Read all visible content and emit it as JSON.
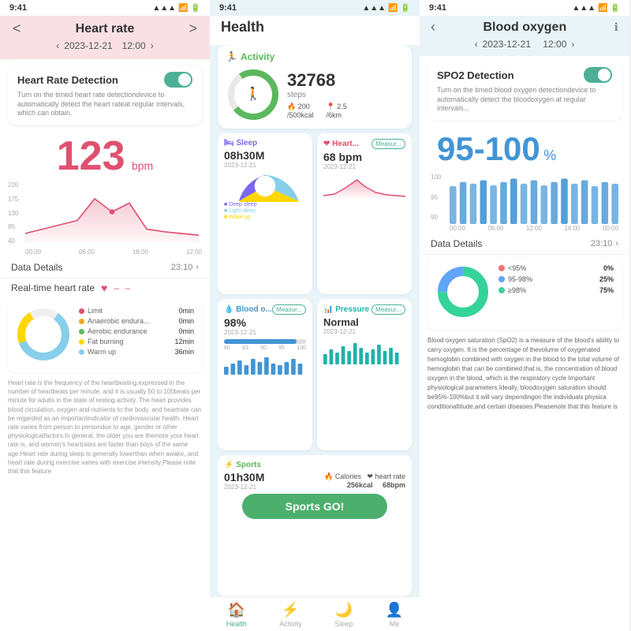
{
  "phone1": {
    "status": {
      "time": "9:41",
      "signal": "●●●",
      "wifi": "wifi",
      "battery": "battery"
    },
    "title": "Heart rate",
    "nav_left": "<",
    "nav_right": ">",
    "date": "2023-12-21",
    "time_label": "12:00",
    "detection_title": "Heart Rate Detection",
    "detection_text": "Turn on the timed heart rate detectiondevice to automatically detect the heart rateat regular intervals, which can obtain.",
    "bpm": "123",
    "bpm_unit": "bpm",
    "chart_y_labels": [
      "220",
      "175",
      "130",
      "85",
      "40"
    ],
    "chart_x_labels": [
      "00:00",
      "06:00",
      "18:00",
      "12:00"
    ],
    "data_details_label": "Data Details",
    "data_details_time": "23:10",
    "realtime_label": "Real-time heart rate",
    "zones": [
      {
        "color": "#e05070",
        "name": "Limit",
        "value": "0min"
      },
      {
        "color": "#f5a623",
        "name": "Anaerobic endura...",
        "value": "0min"
      },
      {
        "color": "#5cb85c",
        "name": "Aerobic endurance",
        "value": "0min"
      },
      {
        "color": "#ffd700",
        "name": "Fat burning",
        "value": "12min"
      },
      {
        "color": "#87ceeb",
        "name": "Warm up",
        "value": "36min"
      }
    ],
    "info_text": "Heart rate is the frequency of the heartbeating,expressed in the number of heartbeats per minute, and it is usually 50 to 100beats per minute for adults in the state of resting activity. The heart provides blood circulation, oxygen and nutrients to the body, and heartrate can be regarded as an importantindicator of cardiovascular health. Heart rate varies from person to persondue to age, gender or other physiologicalfactors.In general, the older you are themore your heart rate is, and women's heartrates are faster than boys of the same age.Heart rate during sleep is generally lowerthan when awake, and heart rate during exercise varies with exercise intensity.Please note that this feature"
  },
  "phone2": {
    "status": {
      "time": "9:41"
    },
    "title": "Health",
    "activity_label": "Activity",
    "steps": "32768",
    "steps_unit": "steps",
    "calories_value": "200",
    "calories_unit": "/500kcal",
    "distance_value": "2.5",
    "distance_unit": "/6km",
    "tiles": [
      {
        "id": "sleep",
        "icon": "🛏",
        "title": "Sleep",
        "value": "08h30M",
        "date": "2023-12-21",
        "has_chart": true,
        "chart_type": "pie",
        "legends": [
          "Deep sleep",
          "Light sleep",
          "Wake up"
        ]
      },
      {
        "id": "heart",
        "icon": "❤",
        "title": "Heart...",
        "value": "68 bpm",
        "date": "2023-12-21",
        "measure_label": "Measur...",
        "has_chart": true,
        "chart_type": "line"
      },
      {
        "id": "blood",
        "icon": "💧",
        "title": "Blood o...",
        "value": "98%",
        "date": "2023-12-21",
        "measure_label": "Measur...",
        "has_chart": true,
        "chart_type": "bar"
      },
      {
        "id": "pressure",
        "icon": "📊",
        "title": "Pressure",
        "value": "Normal",
        "date": "2023-12-21",
        "measure_label": "Measur...",
        "has_chart": true,
        "chart_type": "bar"
      }
    ],
    "sports_icon": "⚡",
    "sports_title": "Sports",
    "sports_duration": "01h30M",
    "sports_date": "2023-12-21",
    "sports_calories_label": "Calories",
    "sports_calories_value": "256kcal",
    "sports_hr_label": "heart rate",
    "sports_hr_value": "68bpm",
    "sports_btn": "Sports GO!",
    "nav_items": [
      {
        "icon": "🏠",
        "label": "Health",
        "active": true
      },
      {
        "icon": "⚡",
        "label": "Activity",
        "active": false
      },
      {
        "icon": "🌙",
        "label": "Sleep",
        "active": false
      },
      {
        "icon": "👤",
        "label": "Me",
        "active": false
      }
    ]
  },
  "phone3": {
    "status": {
      "time": "9:41"
    },
    "title": "Blood oxygen",
    "date": "2023-12-21",
    "time_label": "12:00",
    "spo2_title": "SPO2 Detection",
    "spo2_text": "Turn on the timed blood oxygen detectiondevice to automatically detect the bloodoxygen at regular intervals...",
    "spo2_value": "95-100",
    "spo2_unit": "%",
    "bar_y_labels": [
      "100",
      "95",
      "90"
    ],
    "bar_x_labels": [
      "00:00",
      "06:00",
      "12:00",
      "18:00",
      "00:00"
    ],
    "data_details_label": "Data Details",
    "data_details_time": "23:10",
    "legend_items": [
      {
        "color": "#f87171",
        "label": "<95%",
        "value": "0%"
      },
      {
        "color": "#60a5fa",
        "label": "95-98%",
        "value": "25%"
      },
      {
        "color": "#34d399",
        "label": "≥98%",
        "value": "75%"
      }
    ],
    "description": "Blood oxygen saturation (SpO2) is a measure of the blood's ability to carry oxygen. It is the percentage of thevolume of oxygenated hemoglobin combined with oxygen in the blood to the total volume of hemoglobin that can be combined,that is, the concentration of blood oxygen in the blood, which is the respiratory cycle Important physiological parameters.Ideally, bloodoxygen saturation should be95%-100%but it will vary dependingon the individuals physica conditionaltitude,and certain diseases.Pleasenote that this feature is"
  }
}
